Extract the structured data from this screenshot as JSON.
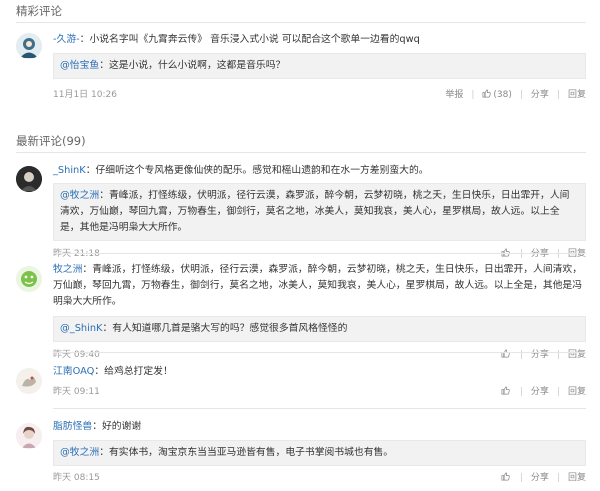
{
  "hot_section": {
    "title": "精彩评论"
  },
  "latest_section": {
    "title": "最新评论(99)"
  },
  "hot_comments": [
    {
      "user": "-久游-",
      "text": "小说名字叫《九霄奔云传》 音乐浸入式小说 可以配合这个歌单一边看的qwq",
      "quote_user": "@怡宝鱼",
      "quote_text": "这是小说，什么小说啊，这都是音乐吗？",
      "time": "11月1日 10:26",
      "report": "举报",
      "likes": "(38)",
      "share": "分享",
      "reply": "回复"
    }
  ],
  "comments": [
    {
      "user": "_ShinK",
      "text": "仔细听这个专风格更像仙侠的配乐。感觉和榣山遗韵和在水一方差别蛮大的。",
      "quote_user": "@牧之洲",
      "quote_text": "青峰派，打怪练级，伏明派，径行云漠，森罗派，醉今朝，云梦初晓，桃之夭，生日快乐，日出霏开，人间清欢，万仙巅，琴回九霄，万物春生，御剑行，莫名之地，冰美人，莫知我哀，美人心，星罗棋局，故人远。以上全是，其他是冯明枭大大所作。",
      "time": "昨天 21:18",
      "share": "分享",
      "reply": "回复"
    },
    {
      "user": "牧之洲",
      "text": "青峰派，打怪练级，伏明派，径行云漠，森罗派，醉今朝，云梦初晓，桃之夭，生日快乐，日出霏开，人间清欢，万仙巅，琴回九霄，万物春生，御剑行，莫名之地，冰美人，莫知我哀，美人心，星罗棋局，故人远。以上全是，其他是冯明枭大大所作。",
      "quote_user": "@_ShinK",
      "quote_text": "有人知道哪几首是骆大写的吗？感觉很多首风格怪怪的",
      "time": "昨天 09:40",
      "share": "分享",
      "reply": "回复"
    },
    {
      "user": "江南OAQ",
      "text": "给鸡总打定发！",
      "quote_user": "",
      "quote_text": "",
      "time": "昨天 09:11",
      "share": "分享",
      "reply": "回复"
    },
    {
      "user": "脂肪怪兽",
      "text": "好的谢谢",
      "quote_user": "@牧之洲",
      "quote_text": "有实体书，淘宝京东当当亚马逊皆有售，电子书掌阅书城也有售。",
      "time": "昨天 08:15",
      "share": "分享",
      "reply": "回复"
    }
  ]
}
